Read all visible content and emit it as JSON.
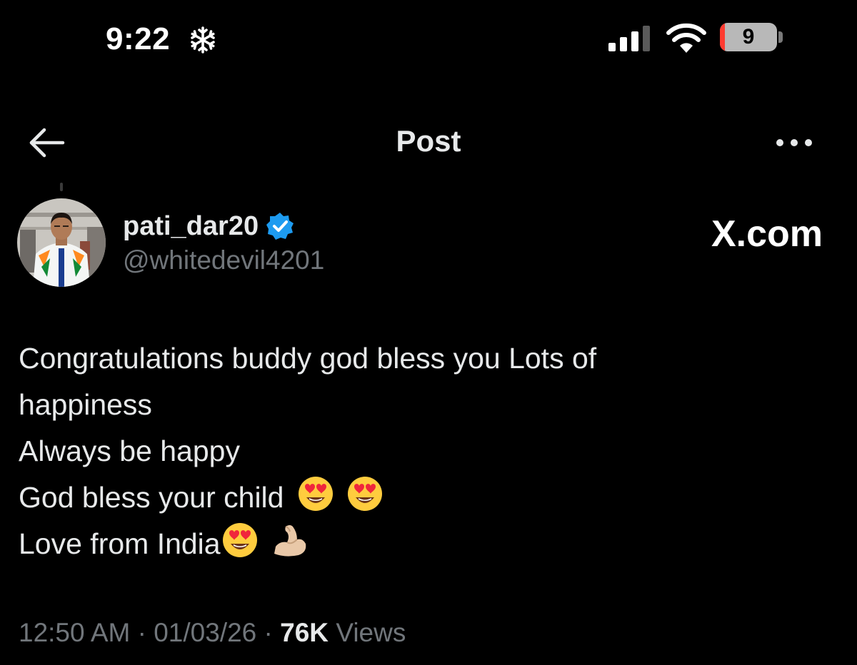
{
  "status_bar": {
    "time": "9:22",
    "battery_level": "9",
    "battery_fraction": 0.09,
    "icons": [
      "snowflake-icon",
      "cellular-signal-icon",
      "wifi-icon",
      "battery-icon"
    ]
  },
  "header": {
    "title": "Post",
    "back_icon": "back-arrow-icon",
    "more_icon": "more-options-icon"
  },
  "author": {
    "display_name": "pati_dar20",
    "handle": "@whitedevil4201",
    "verified": true
  },
  "watermark": "X.com",
  "post": {
    "lines": [
      "Congratulations buddy god bless you Lots of",
      "happiness",
      "Always be happy",
      "God bless your child",
      "Love from India"
    ],
    "emojis": {
      "line4": [
        "heart-eyes-emoji",
        "heart-eyes-emoji"
      ],
      "line5": [
        "heart-eyes-emoji",
        "flexed-biceps-emoji"
      ]
    }
  },
  "meta": {
    "time": "12:50 AM",
    "separator": "·",
    "date": "01/03/26",
    "views_count": "76K",
    "views_label": "Views"
  },
  "colors": {
    "background": "#000000",
    "primary_text": "#e7e9ea",
    "secondary_text": "#71767b",
    "verified_badge": "#1d9bf0",
    "battery_low": "#ff3b30"
  }
}
